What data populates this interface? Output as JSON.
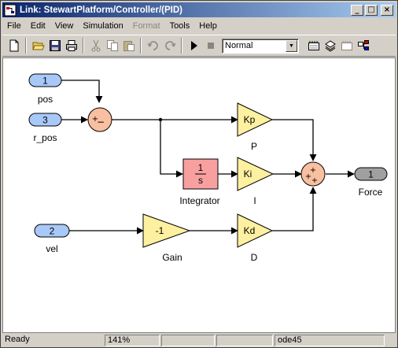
{
  "window": {
    "title": "Link: StewartPlatform/Controller/(PID)",
    "minimize": "_",
    "maximize": "□",
    "close": "×"
  },
  "menu": [
    {
      "label": "File",
      "enabled": true
    },
    {
      "label": "Edit",
      "enabled": true
    },
    {
      "label": "View",
      "enabled": true
    },
    {
      "label": "Simulation",
      "enabled": true
    },
    {
      "label": "Format",
      "enabled": false
    },
    {
      "label": "Tools",
      "enabled": true
    },
    {
      "label": "Help",
      "enabled": true
    }
  ],
  "toolbar": {
    "icons": [
      "new-icon",
      "open-icon",
      "save-icon",
      "print-icon",
      "cut-icon",
      "copy-icon",
      "paste-icon",
      "undo-icon",
      "redo-icon",
      "play-icon",
      "stop-icon",
      "build-icon",
      "update-icon",
      "library-icon",
      "debug-icon"
    ],
    "sim_mode": "Normal"
  },
  "diagram": {
    "inports": [
      {
        "num": "1",
        "name": "pos"
      },
      {
        "num": "3",
        "name": "r_pos"
      },
      {
        "num": "2",
        "name": "vel"
      }
    ],
    "sum1_signs": [
      "+",
      "−"
    ],
    "sum2_signs": [
      "+",
      "+",
      "+"
    ],
    "gains": [
      {
        "label": "Kp",
        "name": "P"
      },
      {
        "label": "Ki",
        "name": "I"
      },
      {
        "label": "Kd",
        "name": "D"
      },
      {
        "label": "-1",
        "name": "Gain"
      }
    ],
    "integrator": {
      "num": "1",
      "den": "s",
      "name": "Integrator"
    },
    "outport": {
      "num": "1",
      "name": "Force"
    },
    "colors": {
      "port": "#a8c8f8",
      "outport": "#a0a0a0",
      "sum": "#f8c0a0",
      "gain": "#fdf0a0",
      "integrator": "#f8a0a0"
    }
  },
  "status": {
    "state": "Ready",
    "zoom": "141%",
    "solver": "ode45"
  }
}
